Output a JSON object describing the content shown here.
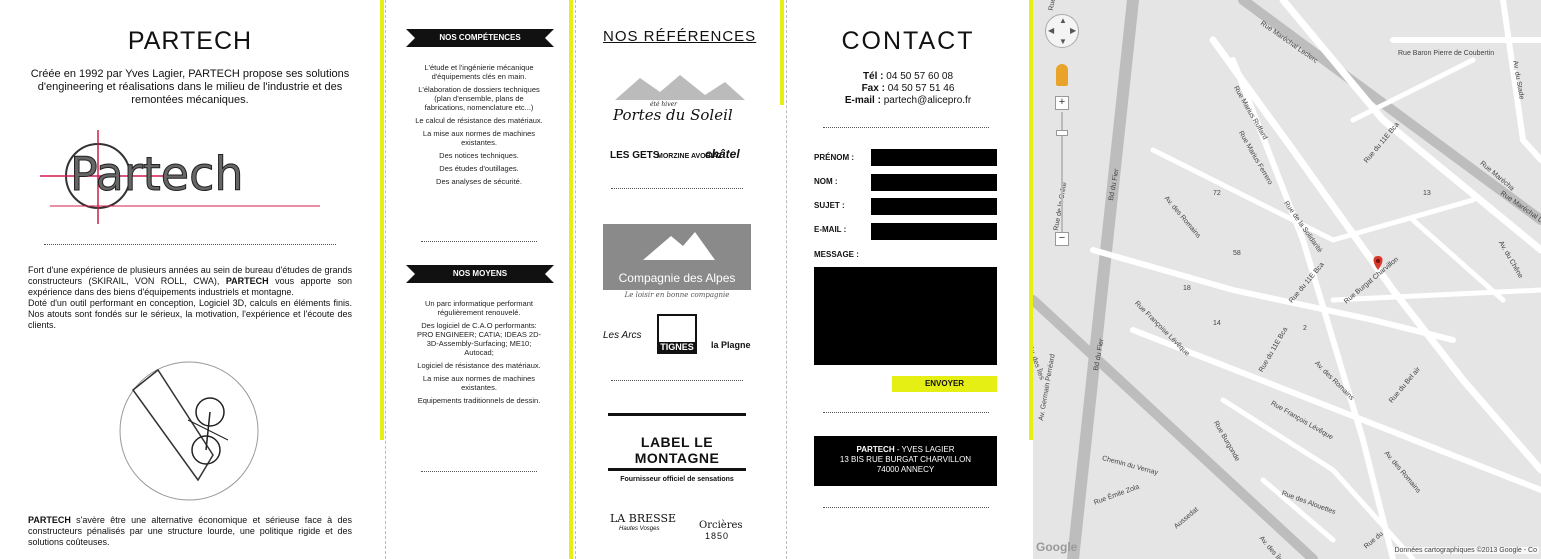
{
  "partech": {
    "title": "PARTECH",
    "intro": "Créée en 1992 par Yves Lagier, PARTECH propose ses solutions d'engineering et réalisations dans le milieu de l'industrie et des remontées mécaniques.",
    "logo_text": "Partech",
    "p1_lead": "Fort d'une expérience de plusieurs années au sein de bureau d'études de grands constructeurs (SKIRAIL, VON ROLL, CWA), ",
    "p1_bold": "PARTECH",
    "p1_tail": " vous apporte son expérience dans des biens d'équipements industriels et montagne.",
    "p2": "Doté d'un outil performant en conception, Logiciel 3D, calculs en éléments finis. Nos atouts sont fondés sur le sérieux, la motivation, l'expérience et l'écoute des clients.",
    "p3_bold": "PARTECH",
    "p3_tail": " s'avère être une alternative économique et sérieuse face à des constructeurs pénalisés par une structure lourde, une politique rigide et des solutions coûteuses."
  },
  "competences": {
    "title": "NOS COMPÉTENCES",
    "items": [
      "L'étude et l'ingénierie mécanique d'équipements clés en main.",
      "L'élaboration de dossiers techniques (plan d'ensemble, plans de fabrications, nomenclature etc...)",
      "Le calcul de résistance des matériaux.",
      "La mise aux normes de machines existantes.",
      "Des notices techniques.",
      "Des études d'outillages.",
      "Des analyses de sécurité."
    ]
  },
  "moyens": {
    "title": "NOS MOYENS",
    "items": [
      "Un parc informatique performant régulièrement renouvelé.",
      "Des logiciel de C.A.O performants: PRO ENGINEER; CATIA; IDEAS 2D-3D-Assembly-Surfacing; ME10; Autocad;",
      "Logiciel de résistance des matériaux.",
      "La mise aux normes de machines existantes.",
      "Equipements traditionnels de dessin."
    ]
  },
  "references": {
    "title": "NOS RÉFÉRENCES",
    "portes_top": "été hiver",
    "portes": "Portes du Soleil",
    "gets": "LES GETS",
    "morzine": "MORZINE AVORIAZ",
    "chatel": "châtel",
    "cda": "Compagnie des Alpes",
    "cda_tag": "Le loisir en bonne compagnie",
    "arcs": "Les Arcs",
    "tignes": "TIGNES",
    "plagne": "la Plagne",
    "label": "LABEL LE MONTAGNE",
    "label_tag": "Fournisseur officiel de sensations",
    "bresse": "LA BRESSE",
    "bresse_tag": "Hautes Vosges",
    "orcieres": "Orcières",
    "orcieres_year": "1850"
  },
  "contact": {
    "title": "CONTACT",
    "tel_label": "Tél :",
    "tel": "04 50 57 60 08",
    "fax_label": "Fax :",
    "fax": "04 50 57 51 46",
    "email_label": "E-mail :",
    "email": "partech@alicepro.fr",
    "form": {
      "prenom": "PRÉNOM :",
      "nom": "NOM :",
      "sujet": "SUJET :",
      "email": "E-MAIL :",
      "message": "MESSAGE :",
      "send": "ENVOYER"
    },
    "address_bold": "PARTECH",
    "address_name": " - YVES LAGIER",
    "address_line1": "13 BIS RUE BURGAT CHARVILLON",
    "address_line2": "74000 ANNECY"
  },
  "map": {
    "google": "Google",
    "copyright": "Données cartographiques ©2013 Google - Co",
    "streets": [
      "Rue Maréchal Leclerc",
      "Rue Baron Pierre de Coubertin",
      "Rue Maréchal Leclerc",
      "Av. du Stade",
      "Rue du Fier",
      "Rue Marius Ruffard",
      "Rue Marius Ferrero",
      "Bd du Fier",
      "Rue de la Solidarité",
      "Av. des Romains",
      "Rue du 11E Bca",
      "Rue Marécha",
      "Rue de la Crête",
      "Rue du 11E Bca",
      "Rue Burgat Charvillon",
      "Av. du Chêne",
      "Rue Françoise Lévêque",
      "Rue du 11E Bca",
      "Av. des Romains",
      "Rue du Bel air",
      "Av. des Îles",
      "Av. Germain Perréard",
      "Bd du Fier",
      "Rue François Lévêque",
      "Rue Burgonde",
      "Av. des Romains",
      "Chemin du Vernay",
      "Rue des Alouettes",
      "Rue Émile Zola",
      "Av. des Îles",
      "Aussedat",
      "Rue du"
    ],
    "numbers": [
      "72",
      "58",
      "18",
      "13",
      "14",
      "2"
    ]
  }
}
